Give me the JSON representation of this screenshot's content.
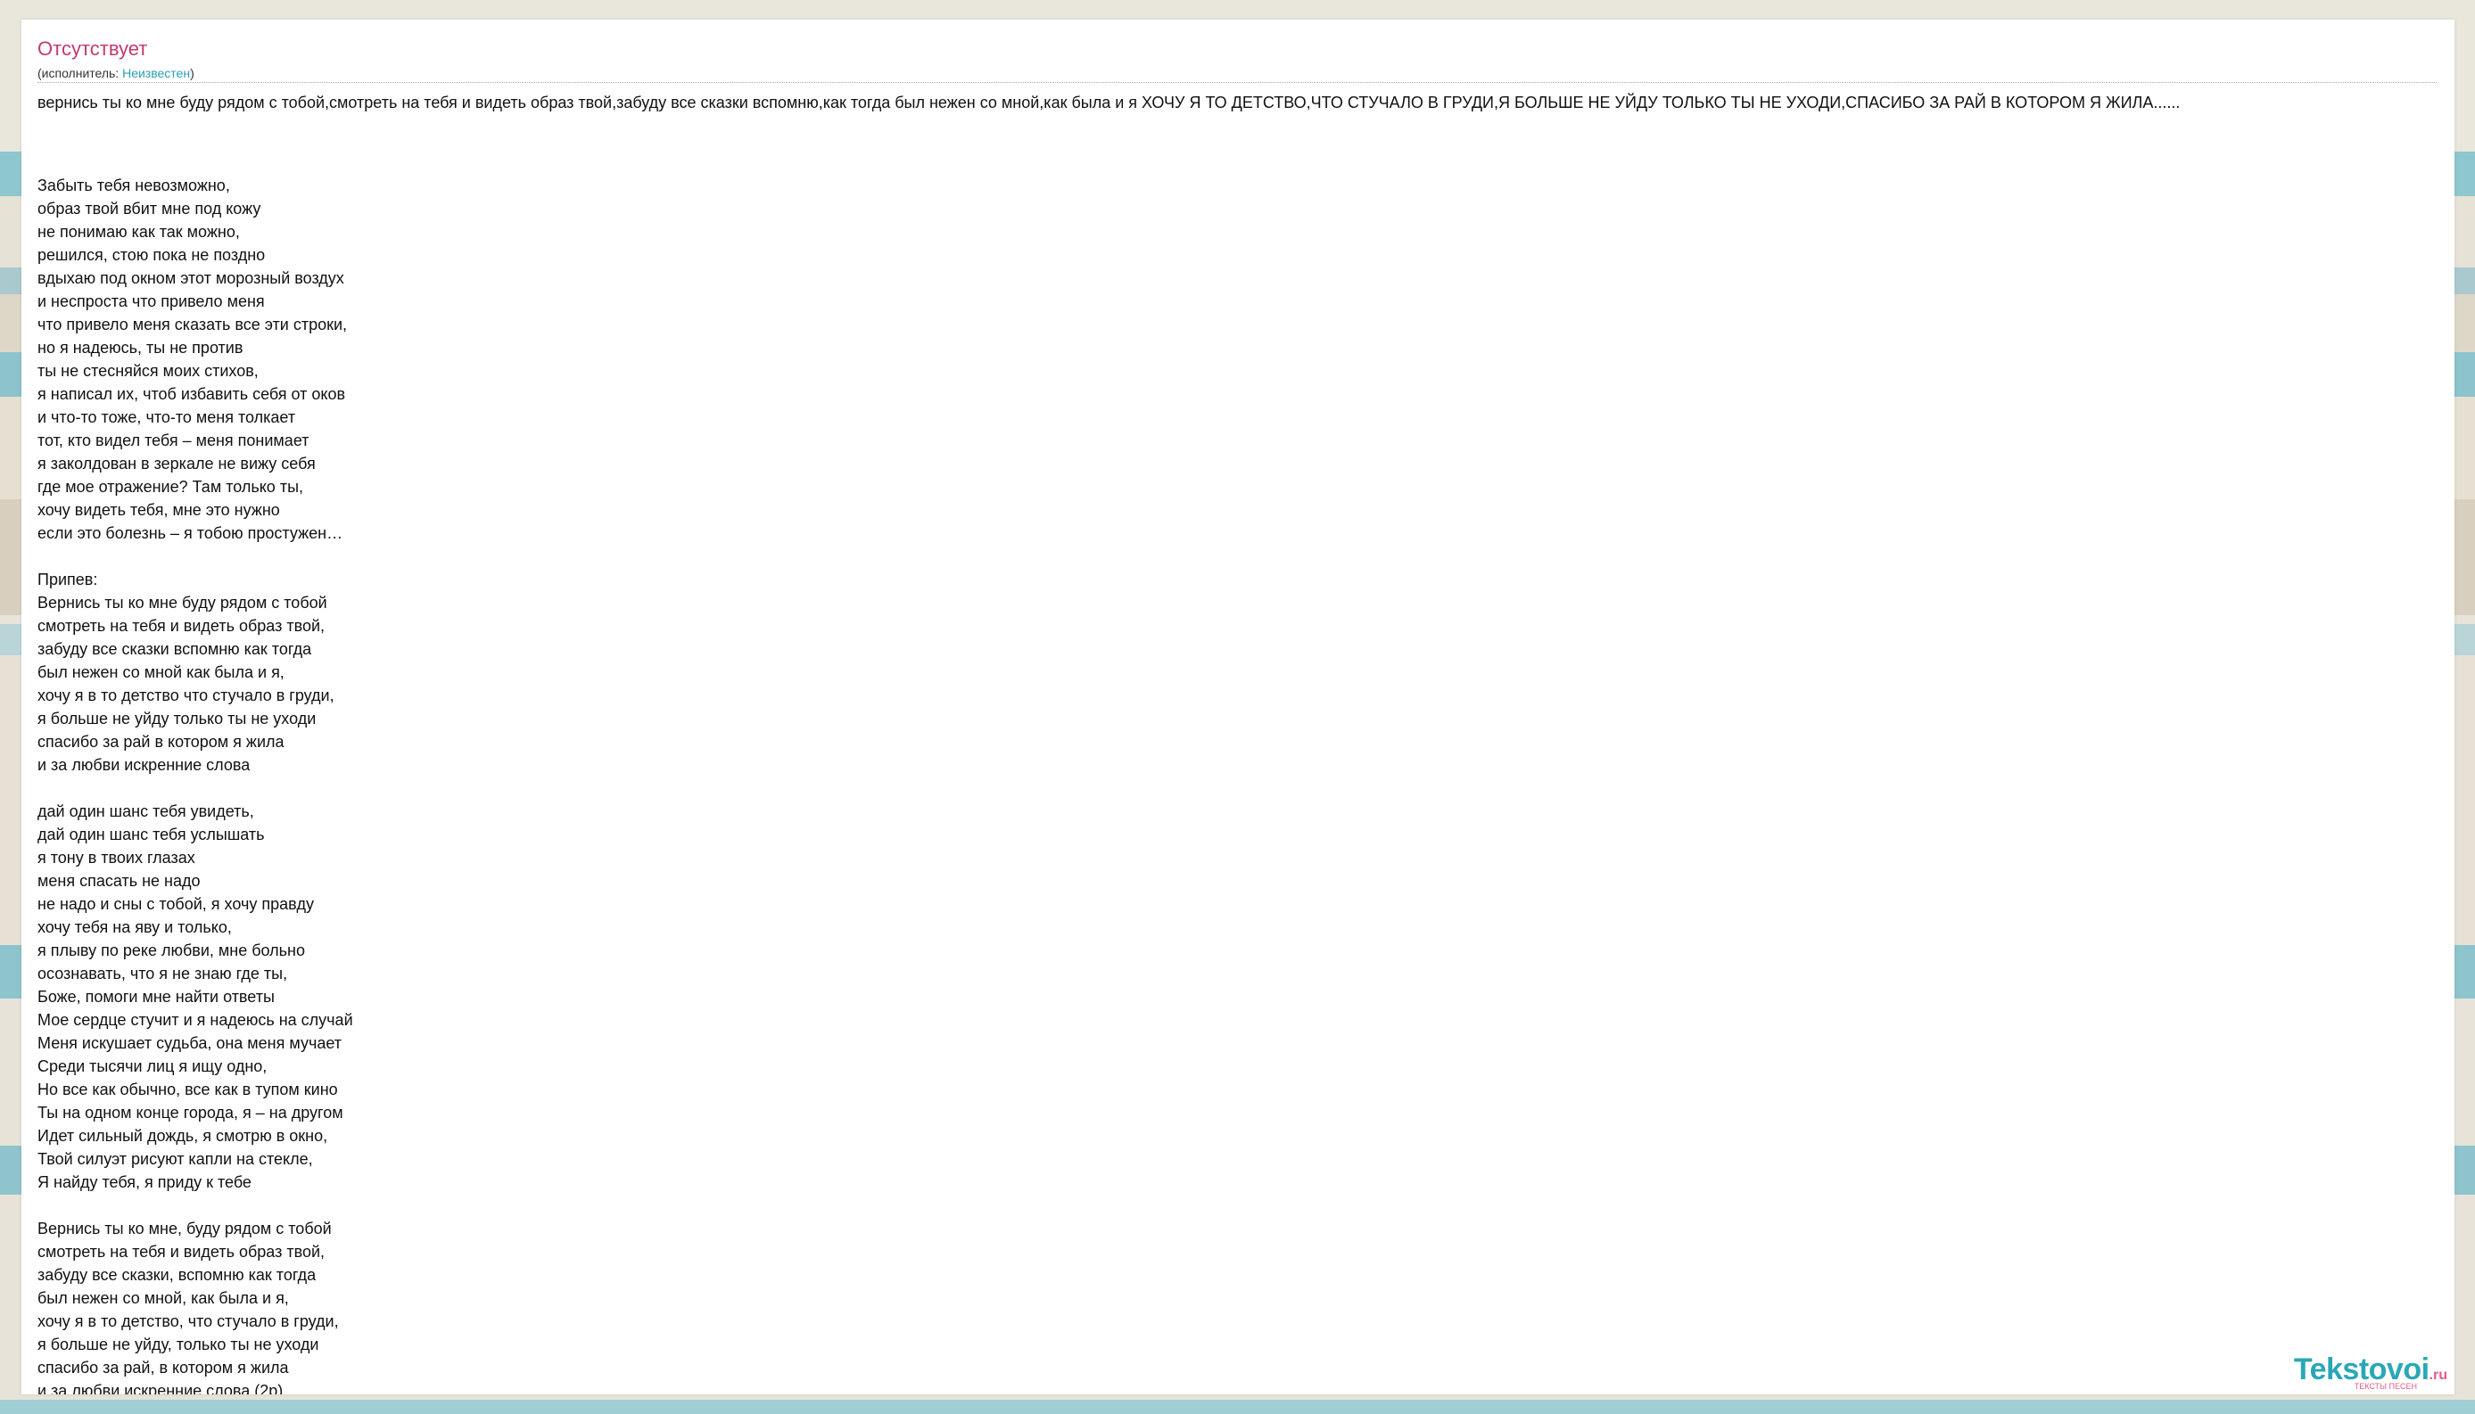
{
  "song": {
    "title": "Отсутствует",
    "artist_prefix": "(исполнитель: ",
    "artist": "Неизвестен",
    "artist_suffix": ")"
  },
  "summary_line": "вернись ты ко мне буду рядом с тобой,смотреть на тебя и видеть образ твой,забуду все сказки вспомню,как тогда был нежен со мной,как была и я  ХОЧУ Я ТО ДЕТСТВО,ЧТО СТУЧАЛО В ГРУДИ,Я БОЛЬШЕ НЕ УЙДУ ТОЛЬКО ТЫ НЕ УХОДИ,СПАСИБО ЗА РАЙ В КОТОРОМ Я ЖИЛА......",
  "lyrics": [
    "",
    "Забыть тебя невозможно,",
    "образ твой вбит мне под кожу",
    "не понимаю как так можно,",
    "решился, стою пока не поздно",
    "вдыхаю под окном этот морозный воздух",
    "и неспроста что привело меня",
    "что привело меня сказать все эти строки,",
    "но я надеюсь, ты не против",
    "ты не стесняйся моих стихов,",
    "я написал их, чтоб избавить себя от оков",
    "и что-то тоже, что-то меня толкает",
    "тот, кто видел тебя – меня понимает",
    "я заколдован в зеркале не вижу себя",
    "где мое отражение? Там только ты,",
    "хочу видеть тебя, мне это нужно",
    "если это болезнь – я тобою простужен…",
    "",
    "Припев:",
    "Вернись ты ко мне буду рядом с тобой",
    "смотреть на тебя и видеть образ твой,",
    "забуду все сказки вспомню как тогда",
    "был нежен со мной как была и я,",
    "хочу я в то детство что стучало в груди,",
    "я больше не уйду только ты не уходи",
    "спасибо за рай в котором я жила",
    "и за любви искренние слова",
    "",
    "дай один шанс тебя увидеть,",
    "дай один шанс тебя услышать",
    "я тону в твоих глазах",
    "меня спасать не надо",
    "не надо и сны с тобой, я хочу правду",
    "хочу тебя на яву и только,",
    "я плыву по реке любви, мне больно",
    "осознавать, что я не знаю где ты,",
    "Боже, помоги мне найти ответы",
    "Мое сердце стучит и я надеюсь на случай",
    "Меня искушает судьба, она меня мучает",
    "Среди тысячи лиц я ищу одно,",
    "Но все как обычно, все как в тупом кино",
    "Ты на одном конце города, я – на другом",
    "Идет сильный дождь, я смотрю в окно,",
    "Твой силуэт рисуют капли на стекле,",
    "Я найду тебя, я приду к тебе",
    "",
    "Вернись ты ко мне, буду рядом с тобой",
    "смотреть на тебя и видеть образ твой,",
    "забуду все сказки, вспомню как тогда",
    "был нежен со мной, как была и я,",
    "хочу я в то детство, что стучало в груди,",
    "я больше не уйду, только ты не уходи",
    "спасибо за рай, в котором я жила",
    "и за любви искренние слова (2р)"
  ],
  "logo": {
    "name": "Tekstovoi",
    "tld": ".ru",
    "tagline": "ТЕКСТЫ ПЕСЕН"
  },
  "colors": {
    "title": "#c23a6e",
    "link": "#2b9fb3",
    "logo_primary": "#2aa7b6",
    "logo_accent": "#e45b86"
  }
}
